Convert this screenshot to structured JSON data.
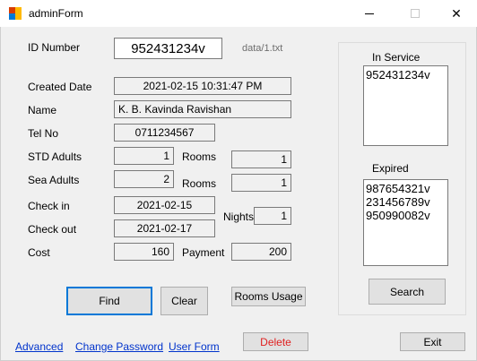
{
  "window": {
    "title": "adminForm",
    "icon": "winforms-app-icon",
    "controls": {
      "minimize": "—",
      "maximize": "☐",
      "close": "✕"
    }
  },
  "form": {
    "id_number": {
      "label": "ID Number",
      "value": "952431234v"
    },
    "file_path": "data/1.txt",
    "created_date": {
      "label": "Created Date",
      "value": "2021-02-15 10:31:47 PM"
    },
    "name": {
      "label": "Name",
      "value": "K. B. Kavinda Ravishan"
    },
    "tel_no": {
      "label": "Tel No",
      "value": "0711234567"
    },
    "std_adults": {
      "label": "STD Adults",
      "value": "1",
      "rooms_label": "Rooms",
      "rooms_value": "1"
    },
    "sea_adults": {
      "label": "Sea Adults",
      "value": "2",
      "rooms_label": "Rooms",
      "rooms_value": "1"
    },
    "check_in": {
      "label": "Check in",
      "value": "2021-02-15"
    },
    "check_out": {
      "label": "Check out",
      "value": "2021-02-17"
    },
    "nights": {
      "label": "Nights",
      "value": "1"
    },
    "cost": {
      "label": "Cost",
      "value": "160"
    },
    "payment": {
      "label": "Payment",
      "value": "200"
    }
  },
  "buttons": {
    "find": "Find",
    "clear": "Clear",
    "rooms_usage": "Rooms Usage",
    "delete": "Delete",
    "exit": "Exit",
    "search": "Search"
  },
  "links": {
    "advanced": "Advanced",
    "change_password": "Change Password",
    "user_form": "User Form"
  },
  "side_panel": {
    "in_service_label": "In Service",
    "in_service": [
      "952431234v"
    ],
    "expired_label": "Expired",
    "expired": [
      "987654321v",
      "231456789v",
      "950990082v"
    ]
  },
  "colors": {
    "focus_border": "#0078d7",
    "delete_text": "#e02020",
    "link": "#0033cc"
  }
}
